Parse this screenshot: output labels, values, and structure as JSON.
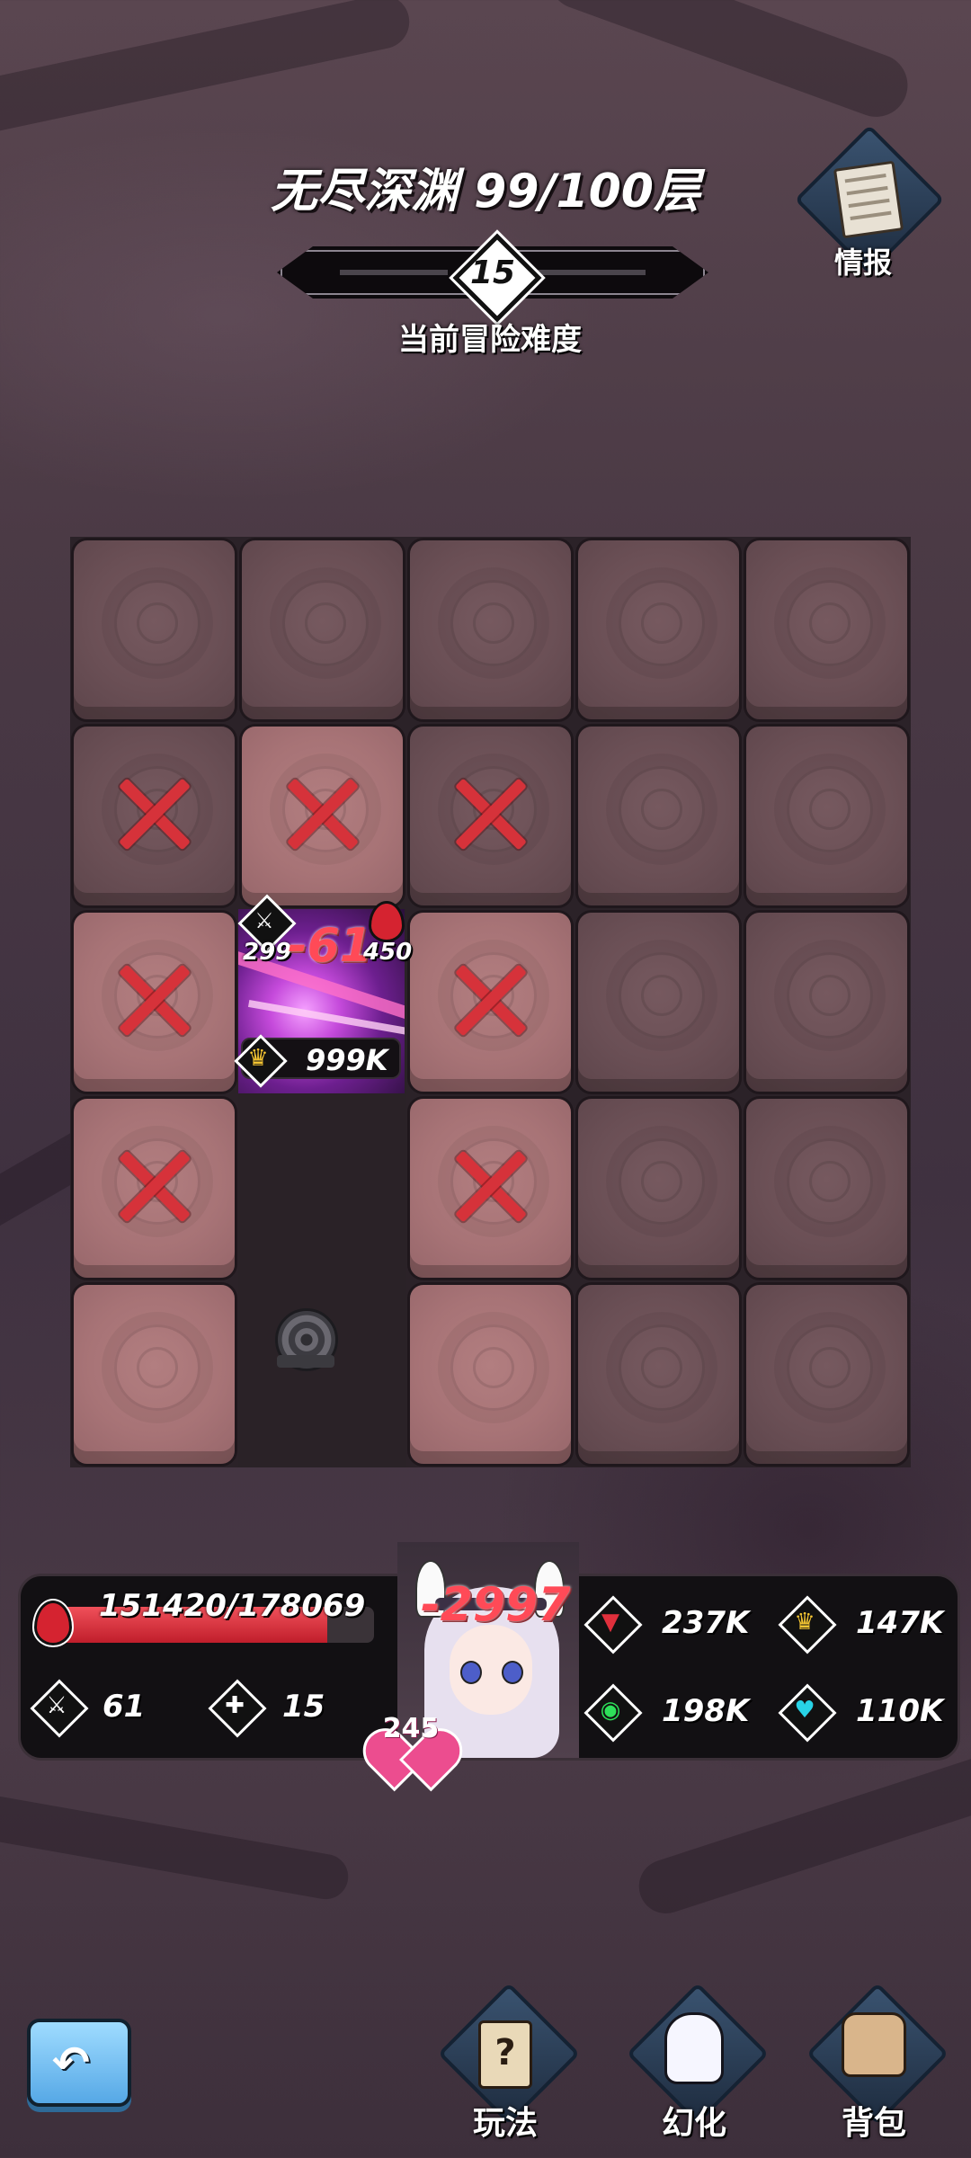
{
  "header": {
    "title": "无尽深渊 99/100层",
    "difficulty_level": "15",
    "difficulty_label": "当前冒险难度",
    "info_label": "情报"
  },
  "grid": {
    "rows": 5,
    "cols": 5,
    "tiles": [
      [
        "dark",
        "dark",
        "dark",
        "dark",
        "dark"
      ],
      [
        "dark-x",
        "light-x",
        "dark-x",
        "dark",
        "dark"
      ],
      [
        "light-x",
        "enemy",
        "light-x",
        "dark",
        "dark"
      ],
      [
        "light-x",
        "empty",
        "light-x",
        "dark",
        "dark"
      ],
      [
        "light",
        "exit",
        "light",
        "dark",
        "dark"
      ]
    ]
  },
  "enemy": {
    "attack": "299",
    "damage_taken": "-61",
    "hp": "450",
    "power": "999K"
  },
  "player": {
    "hp_text": "151420/178069",
    "hp_current": 151420,
    "hp_max": 178069,
    "attack": "61",
    "attack_bonus": "15",
    "damage_taken": "-2997",
    "level": "245",
    "stats": [
      {
        "icon": "fang-icon",
        "value": "237K",
        "color": "#e0303c"
      },
      {
        "icon": "crown-icon",
        "value": "147K",
        "color": "#f4c532"
      },
      {
        "icon": "eye-icon",
        "value": "198K",
        "color": "#2ee05a"
      },
      {
        "icon": "heart-shield-icon",
        "value": "110K",
        "color": "#28d3e6"
      }
    ]
  },
  "bottom_nav": {
    "back_label": "",
    "items": [
      {
        "label": "玩法",
        "icon": "rules-card-icon"
      },
      {
        "label": "幻化",
        "icon": "dragon-icon"
      },
      {
        "label": "背包",
        "icon": "backpack-icon"
      }
    ]
  }
}
